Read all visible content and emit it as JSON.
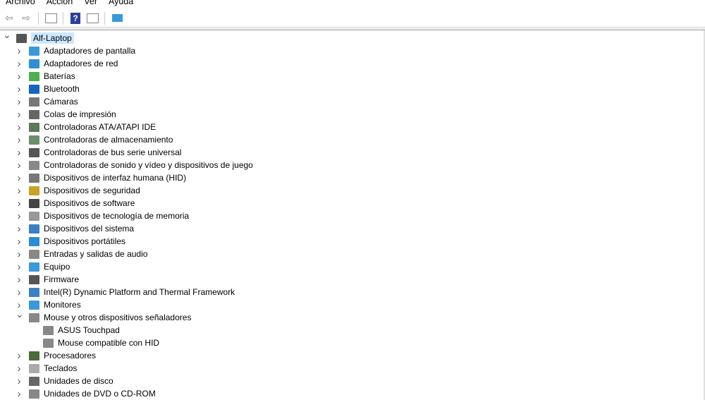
{
  "menu": [
    "Archivo",
    "Acción",
    "Ver",
    "Ayuda"
  ],
  "toolbar": {
    "icons": [
      "back-arrow-icon",
      "forward-arrow-icon",
      "properties-icon",
      "help-icon",
      "update-driver-icon",
      "scan-hardware-icon"
    ]
  },
  "tree": {
    "root": "Alf-Laptop",
    "categories": [
      {
        "label": "Adaptadores de pantalla",
        "color": "#3a9ad9"
      },
      {
        "label": "Adaptadores de red",
        "color": "#2f8fd0"
      },
      {
        "label": "Baterías",
        "color": "#4caf50"
      },
      {
        "label": "Bluetooth",
        "color": "#1565c0"
      },
      {
        "label": "Cámaras",
        "color": "#777777"
      },
      {
        "label": "Colas de impresión",
        "color": "#666666"
      },
      {
        "label": "Controladoras ATA/ATAPI IDE",
        "color": "#5a7a5a"
      },
      {
        "label": "Controladoras de almacenamiento",
        "color": "#6b8e6b"
      },
      {
        "label": "Controladoras de bus serie universal",
        "color": "#555555"
      },
      {
        "label": "Controladoras de sonido y vídeo y dispositivos de juego",
        "color": "#888888"
      },
      {
        "label": "Dispositivos de interfaz humana (HID)",
        "color": "#777777"
      },
      {
        "label": "Dispositivos de seguridad",
        "color": "#c9a227"
      },
      {
        "label": "Dispositivos de software",
        "color": "#444444"
      },
      {
        "label": "Dispositivos de tecnología de memoria",
        "color": "#999999"
      },
      {
        "label": "Dispositivos del sistema",
        "color": "#3b7fc4"
      },
      {
        "label": "Dispositivos portátiles",
        "color": "#2d8bd6"
      },
      {
        "label": "Entradas y salidas de audio",
        "color": "#888888"
      },
      {
        "label": "Equipo",
        "color": "#3a9ad9"
      },
      {
        "label": "Firmware",
        "color": "#555555"
      },
      {
        "label": "Intel(R) Dynamic Platform and Thermal Framework",
        "color": "#3b7fc4"
      },
      {
        "label": "Monitores",
        "color": "#3a9ad9"
      },
      {
        "label": "Mouse y otros dispositivos señaladores",
        "color": "#888888",
        "expanded": true,
        "children": [
          "ASUS Touchpad",
          "Mouse compatible con HID"
        ]
      },
      {
        "label": "Procesadores",
        "color": "#4a6b3a"
      },
      {
        "label": "Teclados",
        "color": "#aaaaaa"
      },
      {
        "label": "Unidades de disco",
        "color": "#666666"
      },
      {
        "label": "Unidades de DVD o CD-ROM",
        "color": "#888888"
      }
    ]
  }
}
